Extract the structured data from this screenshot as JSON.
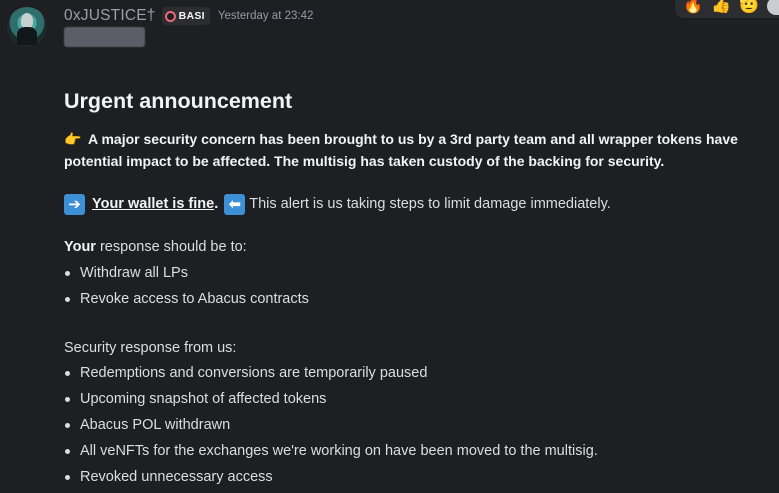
{
  "message": {
    "author": "0xJUSTICE†",
    "role_tag": "BASI",
    "timestamp": "Yesterday at 23:42",
    "title": "Urgent announcement",
    "concern_emoji": "👉",
    "concern": "A major security concern has been brought to us by a 3rd party team and all wrapper tokens have potential impact to be affected. The multisig has taken custody of the backing for security.",
    "right_arrow": "➔",
    "wallet_fine": "Your wallet is fine",
    "period": ".",
    "left_arrow": "⬅",
    "alert_text": "This alert is us taking steps to limit damage immediately.",
    "response_bold": "Your",
    "response_rest": " response should be to:",
    "user_actions": [
      "Withdraw all LPs",
      "Revoke access to Abacus contracts"
    ],
    "security_heading": "Security response from us:",
    "security_actions": [
      "Redemptions and conversions are temporarily paused",
      "Upcoming snapshot of affected tokens",
      "Abacus POL withdrawn",
      "All veNFTs for the exchanges we're working on have been moved to the multisig.",
      "Revoked unnecessary access"
    ]
  },
  "reactions": [
    {
      "emoji": "🔥",
      "icon": "fire-icon"
    },
    {
      "emoji": "👍",
      "icon": "thumbs-up-icon"
    },
    {
      "emoji": "🫡",
      "icon": "salute-face-icon"
    }
  ],
  "colors": {
    "background": "#1e1f22",
    "text": "#dbdee1",
    "role_dot": "#ea6a7a",
    "arrow_box": "#3d8fd6"
  }
}
